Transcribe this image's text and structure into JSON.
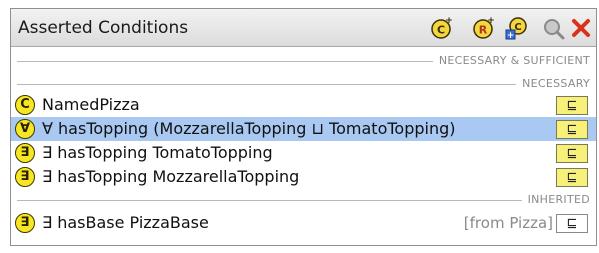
{
  "panel": {
    "title": "Asserted Conditions"
  },
  "toolbar": {
    "buttons": [
      {
        "name": "add-named-class-icon",
        "glyph": "C"
      },
      {
        "name": "add-restriction-icon",
        "glyph": "R"
      },
      {
        "name": "add-expression-icon",
        "glyph": "C"
      },
      {
        "name": "search-icon",
        "glyph": ""
      },
      {
        "name": "delete-icon",
        "glyph": "✕"
      }
    ]
  },
  "sections": {
    "necessary_sufficient": "NECESSARY & SUFFICIENT",
    "necessary": "NECESSARY",
    "inherited": "INHERITED"
  },
  "rows": [
    {
      "badge": "C",
      "expression": "NamedPizza",
      "source": "",
      "subclass": "⊑"
    },
    {
      "badge": "∀",
      "expression": "∀ hasTopping (MozzarellaTopping ⊔ TomatoTopping)",
      "source": "",
      "subclass": "⊑"
    },
    {
      "badge": "∃",
      "expression": "∃ hasTopping TomatoTopping",
      "source": "",
      "subclass": "⊑"
    },
    {
      "badge": "∃",
      "expression": "∃ hasTopping MozzarellaTopping",
      "source": "",
      "subclass": "⊑"
    },
    {
      "badge": "∃",
      "expression": "∃ hasBase PizzaBase",
      "source": "[from Pizza]",
      "subclass": "⊑"
    }
  ],
  "colors": {
    "selection": "#a9c8f2",
    "badge": "#f7e623",
    "subclass_box": "#f7f17a",
    "delete": "#d9321c"
  }
}
